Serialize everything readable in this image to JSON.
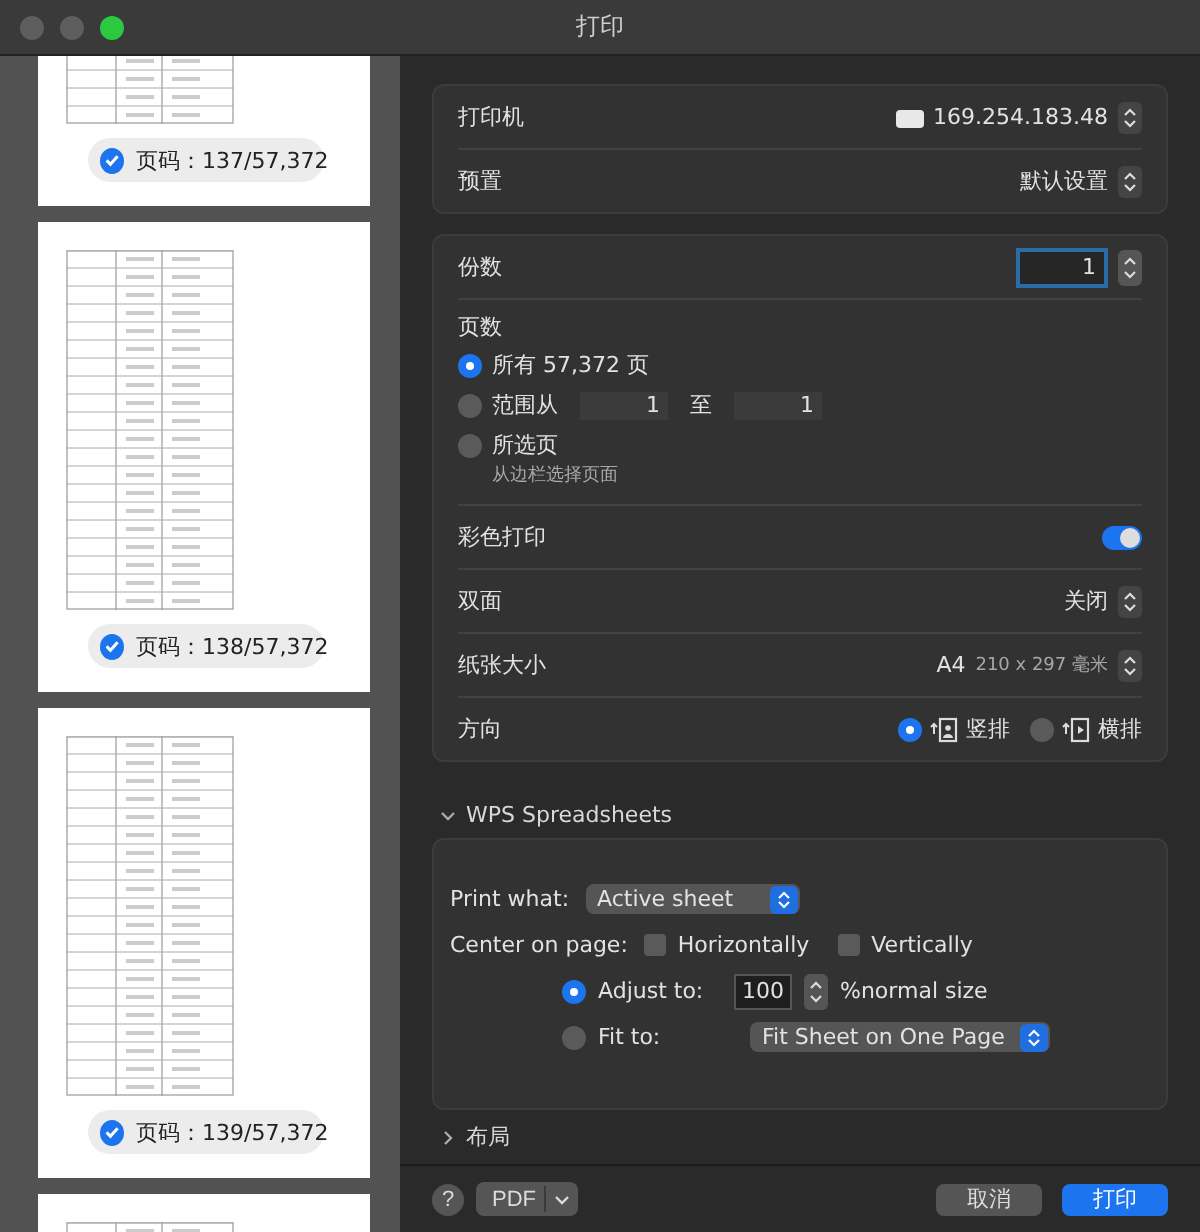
{
  "window": {
    "title": "打印"
  },
  "thumbnails": [
    {
      "kind": "labeled",
      "page_label": "页码：137/57,372",
      "checked": true
    },
    {
      "kind": "labeled",
      "page_label": "页码：138/57,372",
      "checked": true
    },
    {
      "kind": "labeled",
      "page_label": "页码：139/57,372",
      "checked": true
    },
    {
      "kind": "plain"
    }
  ],
  "printer": {
    "label": "打印机",
    "value": "169.254.183.48"
  },
  "preset": {
    "label": "预置",
    "value": "默认设置"
  },
  "copies": {
    "label": "份数",
    "value": "1"
  },
  "pages": {
    "label": "页数",
    "options": [
      {
        "kind": "all",
        "label": "所有 57,372 页",
        "selected": true
      },
      {
        "kind": "range",
        "label": "范围从",
        "selected": false,
        "from": "1",
        "to_label": "至",
        "to": "1"
      },
      {
        "kind": "sidebar",
        "label": "所选页",
        "selected": false,
        "hint": "从边栏选择页面"
      }
    ]
  },
  "color_print": {
    "label": "彩色打印",
    "on": true
  },
  "duplex": {
    "label": "双面",
    "value": "关闭"
  },
  "paper_size": {
    "label": "纸张大小",
    "value": "A4",
    "detail": "210 x 297 毫米"
  },
  "orientation": {
    "label": "方向",
    "options": [
      {
        "kind": "portrait",
        "label": "竖排",
        "selected": true
      },
      {
        "kind": "landscape",
        "label": "横排",
        "selected": false
      }
    ]
  },
  "wps": {
    "title": "WPS Spreadsheets",
    "expanded": true,
    "print_what": {
      "label": "Print what:",
      "value": "Active sheet"
    },
    "center": {
      "label": "Center on page:",
      "options": [
        {
          "label": "Horizontally",
          "checked": false
        },
        {
          "label": "Vertically",
          "checked": false
        }
      ]
    },
    "scaling": [
      {
        "kind": "adjust",
        "label": "Adjust to:",
        "selected": true,
        "value": "100",
        "suffix": "%normal size"
      },
      {
        "kind": "fit",
        "label": "Fit to:",
        "selected": false,
        "value": "Fit Sheet on One Page"
      }
    ]
  },
  "layout_section": {
    "title": "布局",
    "expanded": false
  },
  "footer": {
    "help": "?",
    "pdf": "PDF",
    "cancel": "取消",
    "print": "打印"
  }
}
